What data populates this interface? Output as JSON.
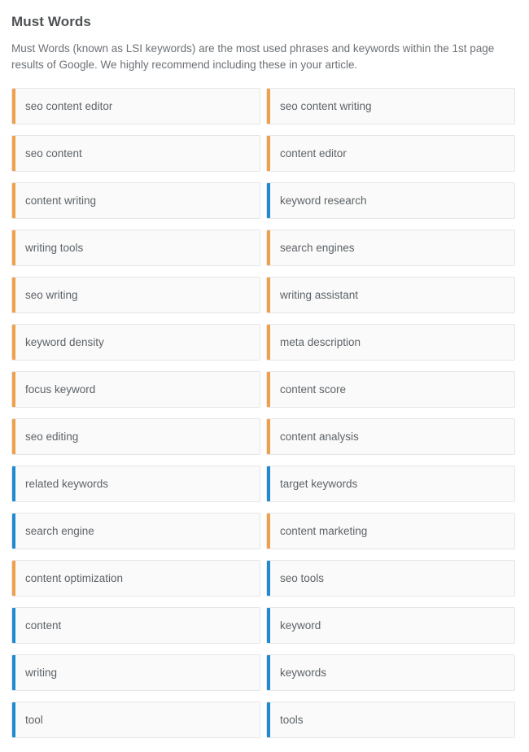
{
  "section": {
    "title": "Must Words",
    "description": "Must Words (known as LSI keywords) are the most used phrases and keywords within the 1st page results of Google. We highly recommend including these in your article."
  },
  "colors": {
    "accent_orange": "#f0a04b",
    "accent_blue": "#1f8ad1",
    "card_background": "#fafafa",
    "card_border": "#e6e6e6",
    "title_text": "#4e5154",
    "body_text": "#6c7176",
    "label_text": "#5d6368"
  },
  "must_words": [
    {
      "label": "seo content editor",
      "accent": "orange"
    },
    {
      "label": "seo content writing",
      "accent": "orange"
    },
    {
      "label": "seo content",
      "accent": "orange"
    },
    {
      "label": "content editor",
      "accent": "orange"
    },
    {
      "label": "content writing",
      "accent": "orange"
    },
    {
      "label": "keyword research",
      "accent": "blue"
    },
    {
      "label": "writing tools",
      "accent": "orange"
    },
    {
      "label": "search engines",
      "accent": "orange"
    },
    {
      "label": "seo writing",
      "accent": "orange"
    },
    {
      "label": "writing assistant",
      "accent": "orange"
    },
    {
      "label": "keyword density",
      "accent": "orange"
    },
    {
      "label": "meta description",
      "accent": "orange"
    },
    {
      "label": "focus keyword",
      "accent": "orange"
    },
    {
      "label": "content score",
      "accent": "orange"
    },
    {
      "label": "seo editing",
      "accent": "orange"
    },
    {
      "label": "content analysis",
      "accent": "orange"
    },
    {
      "label": "related keywords",
      "accent": "blue"
    },
    {
      "label": "target keywords",
      "accent": "blue"
    },
    {
      "label": "search engine",
      "accent": "blue"
    },
    {
      "label": "content marketing",
      "accent": "orange"
    },
    {
      "label": "content optimization",
      "accent": "orange"
    },
    {
      "label": "seo tools",
      "accent": "blue"
    },
    {
      "label": "content",
      "accent": "blue"
    },
    {
      "label": "keyword",
      "accent": "blue"
    },
    {
      "label": "writing",
      "accent": "blue"
    },
    {
      "label": "keywords",
      "accent": "blue"
    },
    {
      "label": "tool",
      "accent": "blue"
    },
    {
      "label": "tools",
      "accent": "blue"
    }
  ]
}
